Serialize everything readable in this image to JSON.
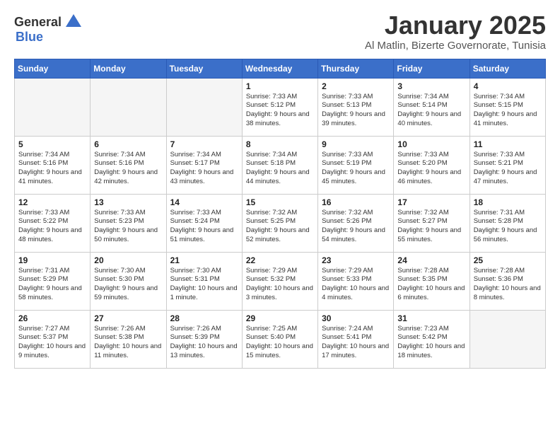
{
  "header": {
    "logo_general": "General",
    "logo_blue": "Blue",
    "title": "January 2025",
    "subtitle": "Al Matlin, Bizerte Governorate, Tunisia"
  },
  "days_of_week": [
    "Sunday",
    "Monday",
    "Tuesday",
    "Wednesday",
    "Thursday",
    "Friday",
    "Saturday"
  ],
  "weeks": [
    [
      {
        "day": "",
        "text": "",
        "shaded": true
      },
      {
        "day": "",
        "text": "",
        "shaded": true
      },
      {
        "day": "",
        "text": "",
        "shaded": true
      },
      {
        "day": "1",
        "text": "Sunrise: 7:33 AM\nSunset: 5:12 PM\nDaylight: 9 hours and 38 minutes.",
        "shaded": false
      },
      {
        "day": "2",
        "text": "Sunrise: 7:33 AM\nSunset: 5:13 PM\nDaylight: 9 hours and 39 minutes.",
        "shaded": false
      },
      {
        "day": "3",
        "text": "Sunrise: 7:34 AM\nSunset: 5:14 PM\nDaylight: 9 hours and 40 minutes.",
        "shaded": false
      },
      {
        "day": "4",
        "text": "Sunrise: 7:34 AM\nSunset: 5:15 PM\nDaylight: 9 hours and 41 minutes.",
        "shaded": false
      }
    ],
    [
      {
        "day": "5",
        "text": "Sunrise: 7:34 AM\nSunset: 5:16 PM\nDaylight: 9 hours and 41 minutes.",
        "shaded": false
      },
      {
        "day": "6",
        "text": "Sunrise: 7:34 AM\nSunset: 5:16 PM\nDaylight: 9 hours and 42 minutes.",
        "shaded": false
      },
      {
        "day": "7",
        "text": "Sunrise: 7:34 AM\nSunset: 5:17 PM\nDaylight: 9 hours and 43 minutes.",
        "shaded": false
      },
      {
        "day": "8",
        "text": "Sunrise: 7:34 AM\nSunset: 5:18 PM\nDaylight: 9 hours and 44 minutes.",
        "shaded": false
      },
      {
        "day": "9",
        "text": "Sunrise: 7:33 AM\nSunset: 5:19 PM\nDaylight: 9 hours and 45 minutes.",
        "shaded": false
      },
      {
        "day": "10",
        "text": "Sunrise: 7:33 AM\nSunset: 5:20 PM\nDaylight: 9 hours and 46 minutes.",
        "shaded": false
      },
      {
        "day": "11",
        "text": "Sunrise: 7:33 AM\nSunset: 5:21 PM\nDaylight: 9 hours and 47 minutes.",
        "shaded": false
      }
    ],
    [
      {
        "day": "12",
        "text": "Sunrise: 7:33 AM\nSunset: 5:22 PM\nDaylight: 9 hours and 48 minutes.",
        "shaded": false
      },
      {
        "day": "13",
        "text": "Sunrise: 7:33 AM\nSunset: 5:23 PM\nDaylight: 9 hours and 50 minutes.",
        "shaded": false
      },
      {
        "day": "14",
        "text": "Sunrise: 7:33 AM\nSunset: 5:24 PM\nDaylight: 9 hours and 51 minutes.",
        "shaded": false
      },
      {
        "day": "15",
        "text": "Sunrise: 7:32 AM\nSunset: 5:25 PM\nDaylight: 9 hours and 52 minutes.",
        "shaded": false
      },
      {
        "day": "16",
        "text": "Sunrise: 7:32 AM\nSunset: 5:26 PM\nDaylight: 9 hours and 54 minutes.",
        "shaded": false
      },
      {
        "day": "17",
        "text": "Sunrise: 7:32 AM\nSunset: 5:27 PM\nDaylight: 9 hours and 55 minutes.",
        "shaded": false
      },
      {
        "day": "18",
        "text": "Sunrise: 7:31 AM\nSunset: 5:28 PM\nDaylight: 9 hours and 56 minutes.",
        "shaded": false
      }
    ],
    [
      {
        "day": "19",
        "text": "Sunrise: 7:31 AM\nSunset: 5:29 PM\nDaylight: 9 hours and 58 minutes.",
        "shaded": false
      },
      {
        "day": "20",
        "text": "Sunrise: 7:30 AM\nSunset: 5:30 PM\nDaylight: 9 hours and 59 minutes.",
        "shaded": false
      },
      {
        "day": "21",
        "text": "Sunrise: 7:30 AM\nSunset: 5:31 PM\nDaylight: 10 hours and 1 minute.",
        "shaded": false
      },
      {
        "day": "22",
        "text": "Sunrise: 7:29 AM\nSunset: 5:32 PM\nDaylight: 10 hours and 3 minutes.",
        "shaded": false
      },
      {
        "day": "23",
        "text": "Sunrise: 7:29 AM\nSunset: 5:33 PM\nDaylight: 10 hours and 4 minutes.",
        "shaded": false
      },
      {
        "day": "24",
        "text": "Sunrise: 7:28 AM\nSunset: 5:35 PM\nDaylight: 10 hours and 6 minutes.",
        "shaded": false
      },
      {
        "day": "25",
        "text": "Sunrise: 7:28 AM\nSunset: 5:36 PM\nDaylight: 10 hours and 8 minutes.",
        "shaded": false
      }
    ],
    [
      {
        "day": "26",
        "text": "Sunrise: 7:27 AM\nSunset: 5:37 PM\nDaylight: 10 hours and 9 minutes.",
        "shaded": false
      },
      {
        "day": "27",
        "text": "Sunrise: 7:26 AM\nSunset: 5:38 PM\nDaylight: 10 hours and 11 minutes.",
        "shaded": false
      },
      {
        "day": "28",
        "text": "Sunrise: 7:26 AM\nSunset: 5:39 PM\nDaylight: 10 hours and 13 minutes.",
        "shaded": false
      },
      {
        "day": "29",
        "text": "Sunrise: 7:25 AM\nSunset: 5:40 PM\nDaylight: 10 hours and 15 minutes.",
        "shaded": false
      },
      {
        "day": "30",
        "text": "Sunrise: 7:24 AM\nSunset: 5:41 PM\nDaylight: 10 hours and 17 minutes.",
        "shaded": false
      },
      {
        "day": "31",
        "text": "Sunrise: 7:23 AM\nSunset: 5:42 PM\nDaylight: 10 hours and 18 minutes.",
        "shaded": false
      },
      {
        "day": "",
        "text": "",
        "shaded": true
      }
    ]
  ]
}
